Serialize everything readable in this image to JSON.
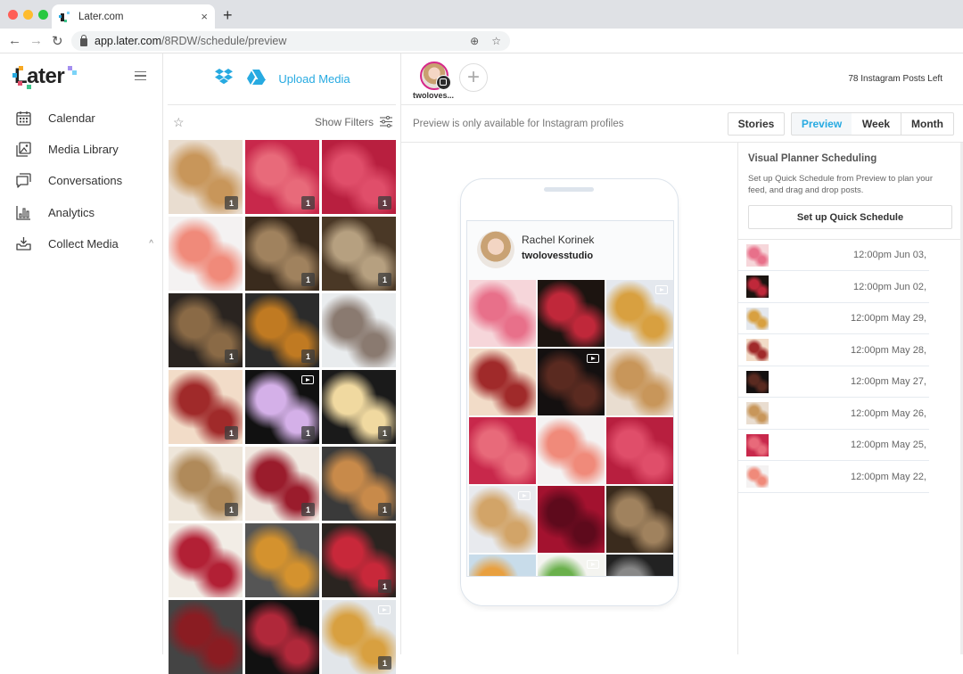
{
  "browser": {
    "tab_title": "Later.com",
    "tab_close": "×",
    "new_tab": "+",
    "url_host": "app.later.com",
    "url_path": "/8RDW/schedule/preview",
    "back": "←",
    "forward": "→",
    "reload": "↻",
    "zoom_icon": "⊕",
    "bookmark_icon": "☆"
  },
  "brand": {
    "logo_text": "Later",
    "accent": "#27aae1",
    "instagram_ring": "#d6288a"
  },
  "sidebar": {
    "items": [
      {
        "label": "Calendar",
        "icon": "calendar-icon"
      },
      {
        "label": "Media Library",
        "icon": "media-library-icon"
      },
      {
        "label": "Conversations",
        "icon": "conversations-icon"
      },
      {
        "label": "Analytics",
        "icon": "analytics-icon"
      },
      {
        "label": "Collect Media",
        "icon": "collect-media-icon",
        "expanded": true
      }
    ],
    "collapse_chevron": "^"
  },
  "media": {
    "upload_label": "Upload Media",
    "show_filters": "Show Filters",
    "star": "☆",
    "items": [
      {
        "palette": [
          "#e9ddd0",
          "#c8965a"
        ],
        "badge": "1"
      },
      {
        "palette": [
          "#c8284b",
          "#e86a7a"
        ],
        "badge": "1"
      },
      {
        "palette": [
          "#b81f3f",
          "#e04e6a"
        ],
        "badge": "1"
      },
      {
        "palette": [
          "#f4f2f2",
          "#f08a7a"
        ],
        "badge": ""
      },
      {
        "palette": [
          "#3a2b1d",
          "#a0825e"
        ],
        "badge": "1"
      },
      {
        "palette": [
          "#4a3826",
          "#b6a080"
        ],
        "badge": "1"
      },
      {
        "palette": [
          "#2a2420",
          "#8a6a46"
        ],
        "badge": "1"
      },
      {
        "palette": [
          "#2b2b2b",
          "#c07a22"
        ],
        "badge": "1"
      },
      {
        "palette": [
          "#e9ecee",
          "#8a7a70"
        ],
        "badge": ""
      },
      {
        "palette": [
          "#f2dcc8",
          "#a02a2a"
        ],
        "badge": "1"
      },
      {
        "palette": [
          "#111111",
          "#d4b0e8"
        ],
        "badge": "1",
        "video": true
      },
      {
        "palette": [
          "#1a1a1a",
          "#f0d9a0"
        ],
        "badge": "1"
      },
      {
        "palette": [
          "#eee6da",
          "#b08a5a"
        ],
        "badge": "1"
      },
      {
        "palette": [
          "#f0e8e0",
          "#9a1c2c"
        ],
        "badge": "1"
      },
      {
        "palette": [
          "#3a3a3a",
          "#c88a4a"
        ],
        "badge": "1"
      },
      {
        "palette": [
          "#f2ede6",
          "#b22035"
        ],
        "badge": ""
      },
      {
        "palette": [
          "#555555",
          "#d4922e"
        ],
        "badge": ""
      },
      {
        "palette": [
          "#2a2420",
          "#c8283a"
        ],
        "badge": "1"
      },
      {
        "palette": [
          "#444444",
          "#8a1c22"
        ],
        "badge": ""
      },
      {
        "palette": [
          "#111111",
          "#b0283a"
        ],
        "badge": ""
      },
      {
        "palette": [
          "#e2e6ea",
          "#d8a040"
        ],
        "badge": "1",
        "video": true
      }
    ]
  },
  "profile": {
    "handle_short": "twoloves...",
    "add_profile": "+",
    "posts_left": "78 Instagram Posts Left"
  },
  "viewbar": {
    "note": "Preview is only available for Instagram profiles",
    "stories": "Stories",
    "views": [
      {
        "label": "Preview",
        "active": true
      },
      {
        "label": "Week",
        "active": false
      },
      {
        "label": "Month",
        "active": false
      }
    ]
  },
  "preview": {
    "name": "Rachel Korinek",
    "username": "twolovesstudio",
    "grid": [
      {
        "palette": [
          "#f6d6da",
          "#e8708a"
        ]
      },
      {
        "palette": [
          "#1c1410",
          "#c0283a"
        ]
      },
      {
        "palette": [
          "#e4e8ee",
          "#d8a040"
        ],
        "video": true
      },
      {
        "palette": [
          "#f2dcc8",
          "#a02a2a"
        ]
      },
      {
        "palette": [
          "#141010",
          "#5a2a20"
        ],
        "video": true
      },
      {
        "palette": [
          "#e9ddd0",
          "#c8965a"
        ]
      },
      {
        "palette": [
          "#c8284b",
          "#e86a7a"
        ]
      },
      {
        "palette": [
          "#f4f2f2",
          "#f08a7a"
        ]
      },
      {
        "palette": [
          "#b81f3f",
          "#e04e6a"
        ]
      },
      {
        "palette": [
          "#e8eaee",
          "#d2a468"
        ],
        "video": true
      },
      {
        "palette": [
          "#a3122f",
          "#5e0a1c"
        ]
      },
      {
        "palette": [
          "#3a2b1d",
          "#a0825e"
        ]
      },
      {
        "palette": [
          "#c8dcea",
          "#e8a040"
        ]
      },
      {
        "palette": [
          "#f4f4f0",
          "#6ab04c"
        ],
        "video": true
      },
      {
        "palette": [
          "#222222",
          "#888888"
        ]
      }
    ]
  },
  "planner": {
    "title": "Visual Planner Scheduling",
    "description": "Set up Quick Schedule from Preview to plan your feed, and drag and drop posts.",
    "button": "Set up Quick Schedule",
    "scheduled": [
      {
        "time": "12:00pm Jun 03,",
        "palette": [
          "#f6d6da",
          "#e8708a"
        ]
      },
      {
        "time": "12:00pm Jun 02,",
        "palette": [
          "#1c1410",
          "#c0283a"
        ]
      },
      {
        "time": "12:00pm May 29,",
        "palette": [
          "#e4e8ee",
          "#d8a040"
        ]
      },
      {
        "time": "12:00pm May 28,",
        "palette": [
          "#f2dcc8",
          "#a02a2a"
        ]
      },
      {
        "time": "12:00pm May 27,",
        "palette": [
          "#141010",
          "#5a2a20"
        ]
      },
      {
        "time": "12:00pm May 26,",
        "palette": [
          "#e9ddd0",
          "#c8965a"
        ]
      },
      {
        "time": "12:00pm May 25,",
        "palette": [
          "#c8284b",
          "#e86a7a"
        ]
      },
      {
        "time": "12:00pm May 22,",
        "palette": [
          "#f4f2f2",
          "#f08a7a"
        ]
      }
    ]
  }
}
